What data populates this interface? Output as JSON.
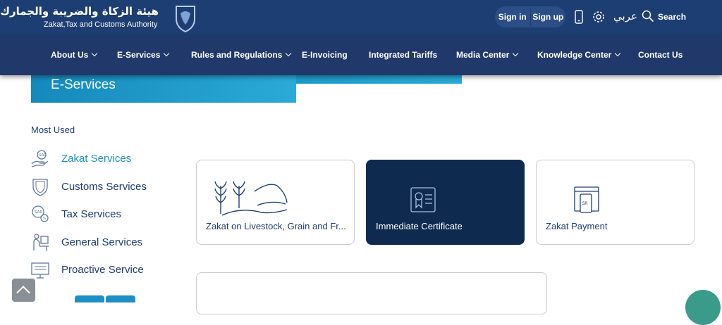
{
  "header": {
    "logo_arabic": "هيئة الزكاة والضريبة والجمارك",
    "logo_english": "Zakat,Tax and Customs Authority",
    "sign_in": "Sign in",
    "sign_up": "Sign up",
    "language": "عربي",
    "search": "Search"
  },
  "nav": [
    {
      "label": "About Us",
      "has_dropdown": true
    },
    {
      "label": "E-Services",
      "has_dropdown": true
    },
    {
      "label": "Rules and Regulations",
      "has_dropdown": true
    },
    {
      "label": "E-Invoicing",
      "has_dropdown": false
    },
    {
      "label": "Integrated Tariffs",
      "has_dropdown": false
    },
    {
      "label": "Media Center",
      "has_dropdown": true
    },
    {
      "label": "Knowledge Center",
      "has_dropdown": true
    },
    {
      "label": "Contact Us",
      "has_dropdown": false
    }
  ],
  "page": {
    "title": "E-Services",
    "most_used_heading": "Most Used"
  },
  "sidebar": [
    {
      "label": "Zakat Services",
      "icon": "zakat-hand-icon",
      "active": true
    },
    {
      "label": "Customs Services",
      "icon": "shield-icon",
      "active": false
    },
    {
      "label": "Tax Services",
      "icon": "coins-icon",
      "active": false
    },
    {
      "label": "General Services",
      "icon": "person-desk-icon",
      "active": false
    },
    {
      "label": "Proactive Service",
      "icon": "monitor-icon",
      "active": false
    }
  ],
  "cards": [
    {
      "label": "Zakat on Livestock, Grain and Fr...",
      "icon": "grain-livestock-icon",
      "selected": false
    },
    {
      "label": "Immediate Certificate",
      "icon": "certificate-icon",
      "selected": true
    },
    {
      "label": "Zakat Payment",
      "icon": "payment-card-icon",
      "selected": false
    }
  ],
  "colors": {
    "topbar": "#1d3e72",
    "navbar": "#21386a",
    "accent": "#1d8fc1",
    "card_selected": "#0e2a4f"
  }
}
